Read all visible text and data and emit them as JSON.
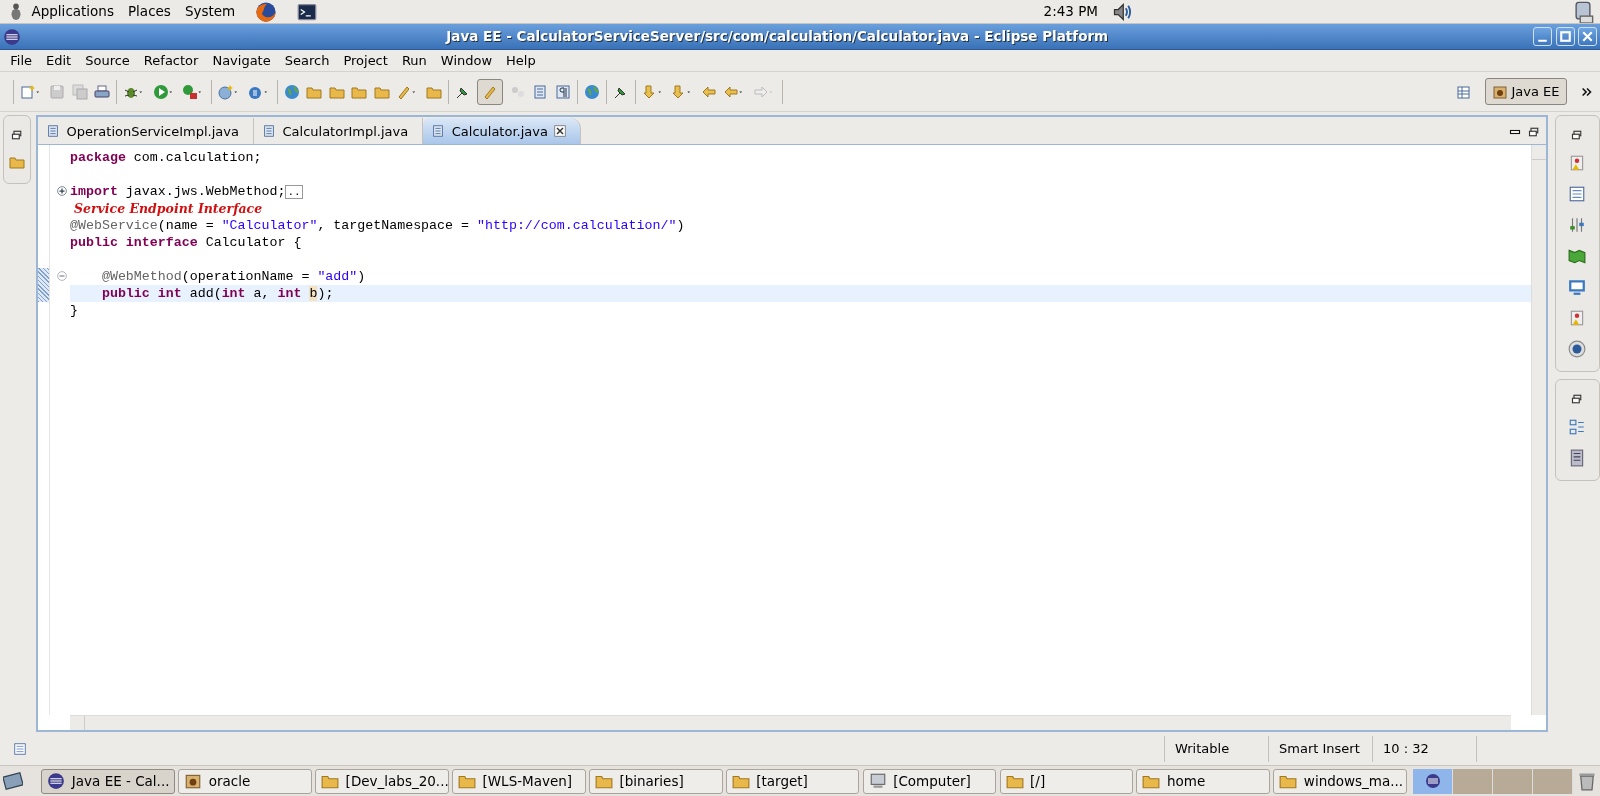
{
  "top_panel": {
    "menus": [
      "Applications",
      "Places",
      "System"
    ],
    "clock": "2:43 PM"
  },
  "window": {
    "title": "Java EE - CalculatorServiceServer/src/com/calculation/Calculator.java - Eclipse Platform"
  },
  "menu_bar": [
    "File",
    "Edit",
    "Source",
    "Refactor",
    "Navigate",
    "Search",
    "Project",
    "Run",
    "Window",
    "Help"
  ],
  "perspective": {
    "label": "Java EE",
    "selected": true
  },
  "editor": {
    "tabs": [
      {
        "label": "OperationServiceImpl.java",
        "selected": false
      },
      {
        "label": "CalculatorImpl.java",
        "selected": false
      },
      {
        "label": "Calculator.java",
        "selected": true
      }
    ],
    "lines": [
      {
        "current": false,
        "changed": false,
        "tokens": [
          {
            "kind": "keyword",
            "text": "package"
          },
          {
            "kind": "plain",
            "text": " com.calculation;"
          }
        ]
      },
      {
        "current": false,
        "changed": false
      },
      {
        "current": false,
        "changed": false,
        "folded": true,
        "tokens": [
          {
            "kind": "keyword",
            "text": "import"
          },
          {
            "kind": "plain",
            "text": " javax.jws.WebMethod;"
          },
          {
            "kind": "folded",
            "text": ".."
          }
        ]
      },
      {
        "current": false,
        "changed": false,
        "note": "Service Endpoint Interface"
      },
      {
        "current": false,
        "changed": false,
        "tokens": [
          {
            "kind": "annotation",
            "text": "@WebService"
          },
          {
            "kind": "plain",
            "text": "(name = "
          },
          {
            "kind": "string",
            "text": "\"Calculator\""
          },
          {
            "kind": "plain",
            "text": ", targetNamespace = "
          },
          {
            "kind": "string",
            "text": "\"http://com.calculation/\""
          },
          {
            "kind": "plain",
            "text": ")"
          }
        ]
      },
      {
        "current": false,
        "changed": false,
        "tokens": [
          {
            "kind": "keyword",
            "text": "public interface"
          },
          {
            "kind": "plain",
            "text": " Calculator {"
          }
        ]
      },
      {
        "current": false,
        "changed": false
      },
      {
        "current": false,
        "changed": true,
        "folded": false,
        "tokens": [
          {
            "kind": "annotation",
            "text": "    @WebMethod"
          },
          {
            "kind": "plain",
            "text": "(operationName = "
          },
          {
            "kind": "string",
            "text": "\"add\""
          },
          {
            "kind": "plain",
            "text": ")"
          }
        ]
      },
      {
        "current": true,
        "changed": true,
        "tokens": [
          {
            "kind": "keyword",
            "text": "    public int"
          },
          {
            "kind": "plain",
            "text": " add("
          },
          {
            "kind": "keyword",
            "text": "int"
          },
          {
            "kind": "plain",
            "text": " a, "
          },
          {
            "kind": "keyword",
            "text": "int "
          },
          {
            "kind": "occurrence",
            "text": "b"
          },
          {
            "kind": "plain",
            "text": ");"
          }
        ]
      },
      {
        "current": false,
        "changed": false,
        "tokens": [
          {
            "kind": "plain",
            "text": "}"
          }
        ]
      }
    ]
  },
  "status_bar": {
    "fields": [
      "Writable",
      "Smart Insert",
      "10 : 32"
    ]
  },
  "taskbar": {
    "items": [
      {
        "label": "Java EE - Cal...",
        "kind": "eclipse",
        "selected": true
      },
      {
        "label": "oracle",
        "kind": "package",
        "selected": false
      },
      {
        "label": "[Dev_labs_20...",
        "kind": "folder",
        "selected": false
      },
      {
        "label": "[WLS-Maven]",
        "kind": "folder",
        "selected": false
      },
      {
        "label": "[binaries]",
        "kind": "folder",
        "selected": false
      },
      {
        "label": "[target]",
        "kind": "folder",
        "selected": false
      },
      {
        "label": "[Computer]",
        "kind": "computer",
        "selected": false
      },
      {
        "label": "[/]",
        "kind": "folder",
        "selected": false
      },
      {
        "label": "home",
        "kind": "folder",
        "selected": false
      },
      {
        "label": "windows_ma...",
        "kind": "folder",
        "selected": false
      }
    ],
    "workspaces": [
      {
        "selected": true
      },
      {
        "selected": false
      },
      {
        "selected": false
      },
      {
        "selected": false
      }
    ]
  }
}
